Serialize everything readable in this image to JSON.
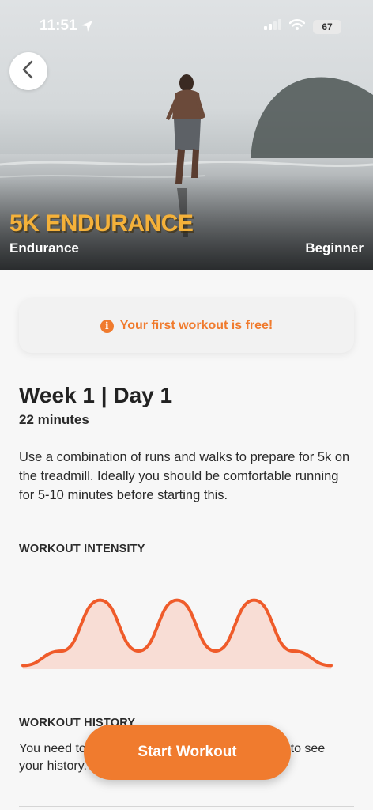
{
  "status_bar": {
    "time": "11:51",
    "battery": "67"
  },
  "hero": {
    "title": "5K ENDURANCE",
    "category": "Endurance",
    "level": "Beginner"
  },
  "notice": {
    "text": "Your first workout is free!",
    "icon": "info-icon",
    "color": "#f07b2e"
  },
  "workout": {
    "title": "Week 1 | Day 1",
    "duration": "22 minutes",
    "description": "Use a combination of runs and walks to prepare for 5k on the treadmill. Ideally you should be comfortable running for 5-10 minutes before starting this."
  },
  "intensity": {
    "label": "WORKOUT INTENSITY",
    "profile": [
      0.05,
      0.25,
      0.95,
      0.25,
      0.95,
      0.25,
      0.95,
      0.25,
      0.05
    ],
    "line_color": "#ef5b2a",
    "fill_color": "#f8ddd5"
  },
  "history": {
    "label": "WORKOUT HISTORY",
    "text": "You need to complete this workout at least once to see your history."
  },
  "cta": {
    "label": "Start Workout",
    "color": "#f07b2e"
  }
}
